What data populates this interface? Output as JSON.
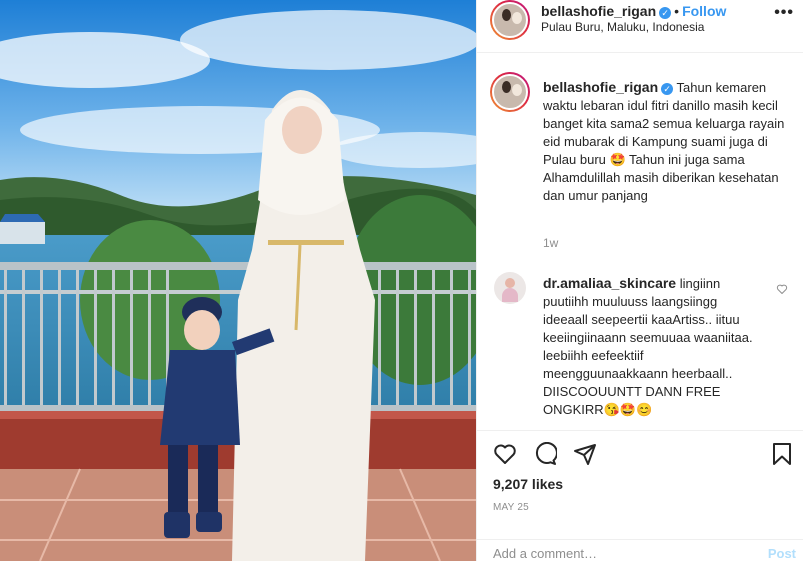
{
  "post": {
    "username": "bellashofie_rigan",
    "follow_label": "Follow",
    "separator": "•",
    "location": "Pulau Buru, Maluku, Indonesia",
    "more_label": "•••"
  },
  "caption": {
    "username": "bellashofie_rigan",
    "text": "Tahun kemaren waktu lebaran idul fitri danillo masih kecil banget kita sama2 semua keluarga rayain eid mubarak di Kampung suami juga di Pulau buru 🤩 Tahun ini juga sama Alhamdulillah masih diberikan kesehatan dan umur panjang",
    "time": "1w"
  },
  "comment": {
    "username": "dr.amaliaa_skincare",
    "text": "lingiinn puutiihh muuluuss laangsiingg ideeaall seepeertii kaaArtiss.. iituu keeiingiinaann seemuuaa waaniitaa. leebiihh eefeektiif meengguunaakkaann heerbaall.. DIISCOOUUNTT DANN FREE ONGKIRR😘🤩😊"
  },
  "actions": {
    "likes": "9,207 likes",
    "date": "MAY 25",
    "comment_placeholder": "Add a comment…",
    "post_label": "Post"
  },
  "icons": [
    "heart-icon",
    "comment-icon",
    "share-icon",
    "bookmark-icon",
    "more-icon",
    "verified-icon",
    "comment-like-icon"
  ],
  "colors": {
    "accent": "#3897f0",
    "post_disabled": "#b2dffc",
    "muted": "#8e8e8e",
    "text": "#262626"
  }
}
